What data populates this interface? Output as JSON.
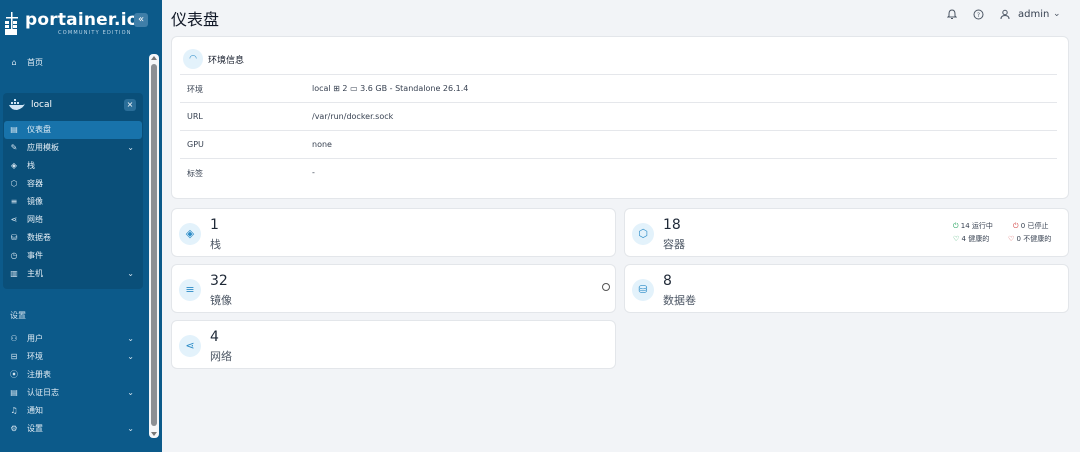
{
  "brand": {
    "name": "portainer.io",
    "edition": "COMMUNITY EDITION"
  },
  "sidebar": {
    "collapse_label": "«",
    "home": {
      "label": "首页",
      "icon": "home-icon"
    },
    "environment": {
      "name": "local",
      "close_label": "×"
    },
    "env_items": [
      {
        "label": "仪表盘",
        "icon": "dashboard-icon",
        "active": true
      },
      {
        "label": "应用模板",
        "icon": "edit-icon",
        "chevron": "⌄"
      },
      {
        "label": "栈",
        "icon": "stack-icon"
      },
      {
        "label": "容器",
        "icon": "box-icon"
      },
      {
        "label": "镜像",
        "icon": "list-icon"
      },
      {
        "label": "网络",
        "icon": "share-icon"
      },
      {
        "label": "数据卷",
        "icon": "database-icon"
      },
      {
        "label": "事件",
        "icon": "clock-icon"
      },
      {
        "label": "主机",
        "icon": "host-icon",
        "chevron": "⌄"
      }
    ],
    "settings_title": "设置",
    "settings_items": [
      {
        "label": "用户",
        "icon": "users-icon",
        "chevron": "⌄"
      },
      {
        "label": "环境",
        "icon": "environment-icon",
        "chevron": "⌄"
      },
      {
        "label": "注册表",
        "icon": "registry-icon"
      },
      {
        "label": "认证日志",
        "icon": "log-icon",
        "chevron": "⌄"
      },
      {
        "label": "通知",
        "icon": "bell-icon"
      },
      {
        "label": "设置",
        "icon": "gear-icon",
        "chevron": "⌄"
      }
    ]
  },
  "header": {
    "title": "仪表盘",
    "user": "admin",
    "user_chevron": "⌄"
  },
  "env_info": {
    "title": "环境信息",
    "rows": [
      {
        "key": "环境",
        "value": "local ⊞ 2 ▭ 3.6 GB - Standalone 26.1.4"
      },
      {
        "key": "URL",
        "value": "/var/run/docker.sock"
      },
      {
        "key": "GPU",
        "value": "none"
      },
      {
        "key": "标签",
        "value": "-"
      }
    ]
  },
  "stats": {
    "stacks": {
      "count": "1",
      "label": "栈"
    },
    "containers": {
      "count": "18",
      "label": "容器",
      "running": "14 运行中",
      "stopped": "0 已停止",
      "healthy": "4 健康的",
      "unhealthy": "0 不健康的"
    },
    "images": {
      "count": "32",
      "label": "镜像"
    },
    "volumes": {
      "count": "8",
      "label": "数据卷"
    },
    "networks": {
      "count": "4",
      "label": "网络"
    }
  },
  "colors": {
    "sidebar": "#0c5a8a",
    "active": "#1873ab",
    "accent": "#2b8bc7"
  }
}
